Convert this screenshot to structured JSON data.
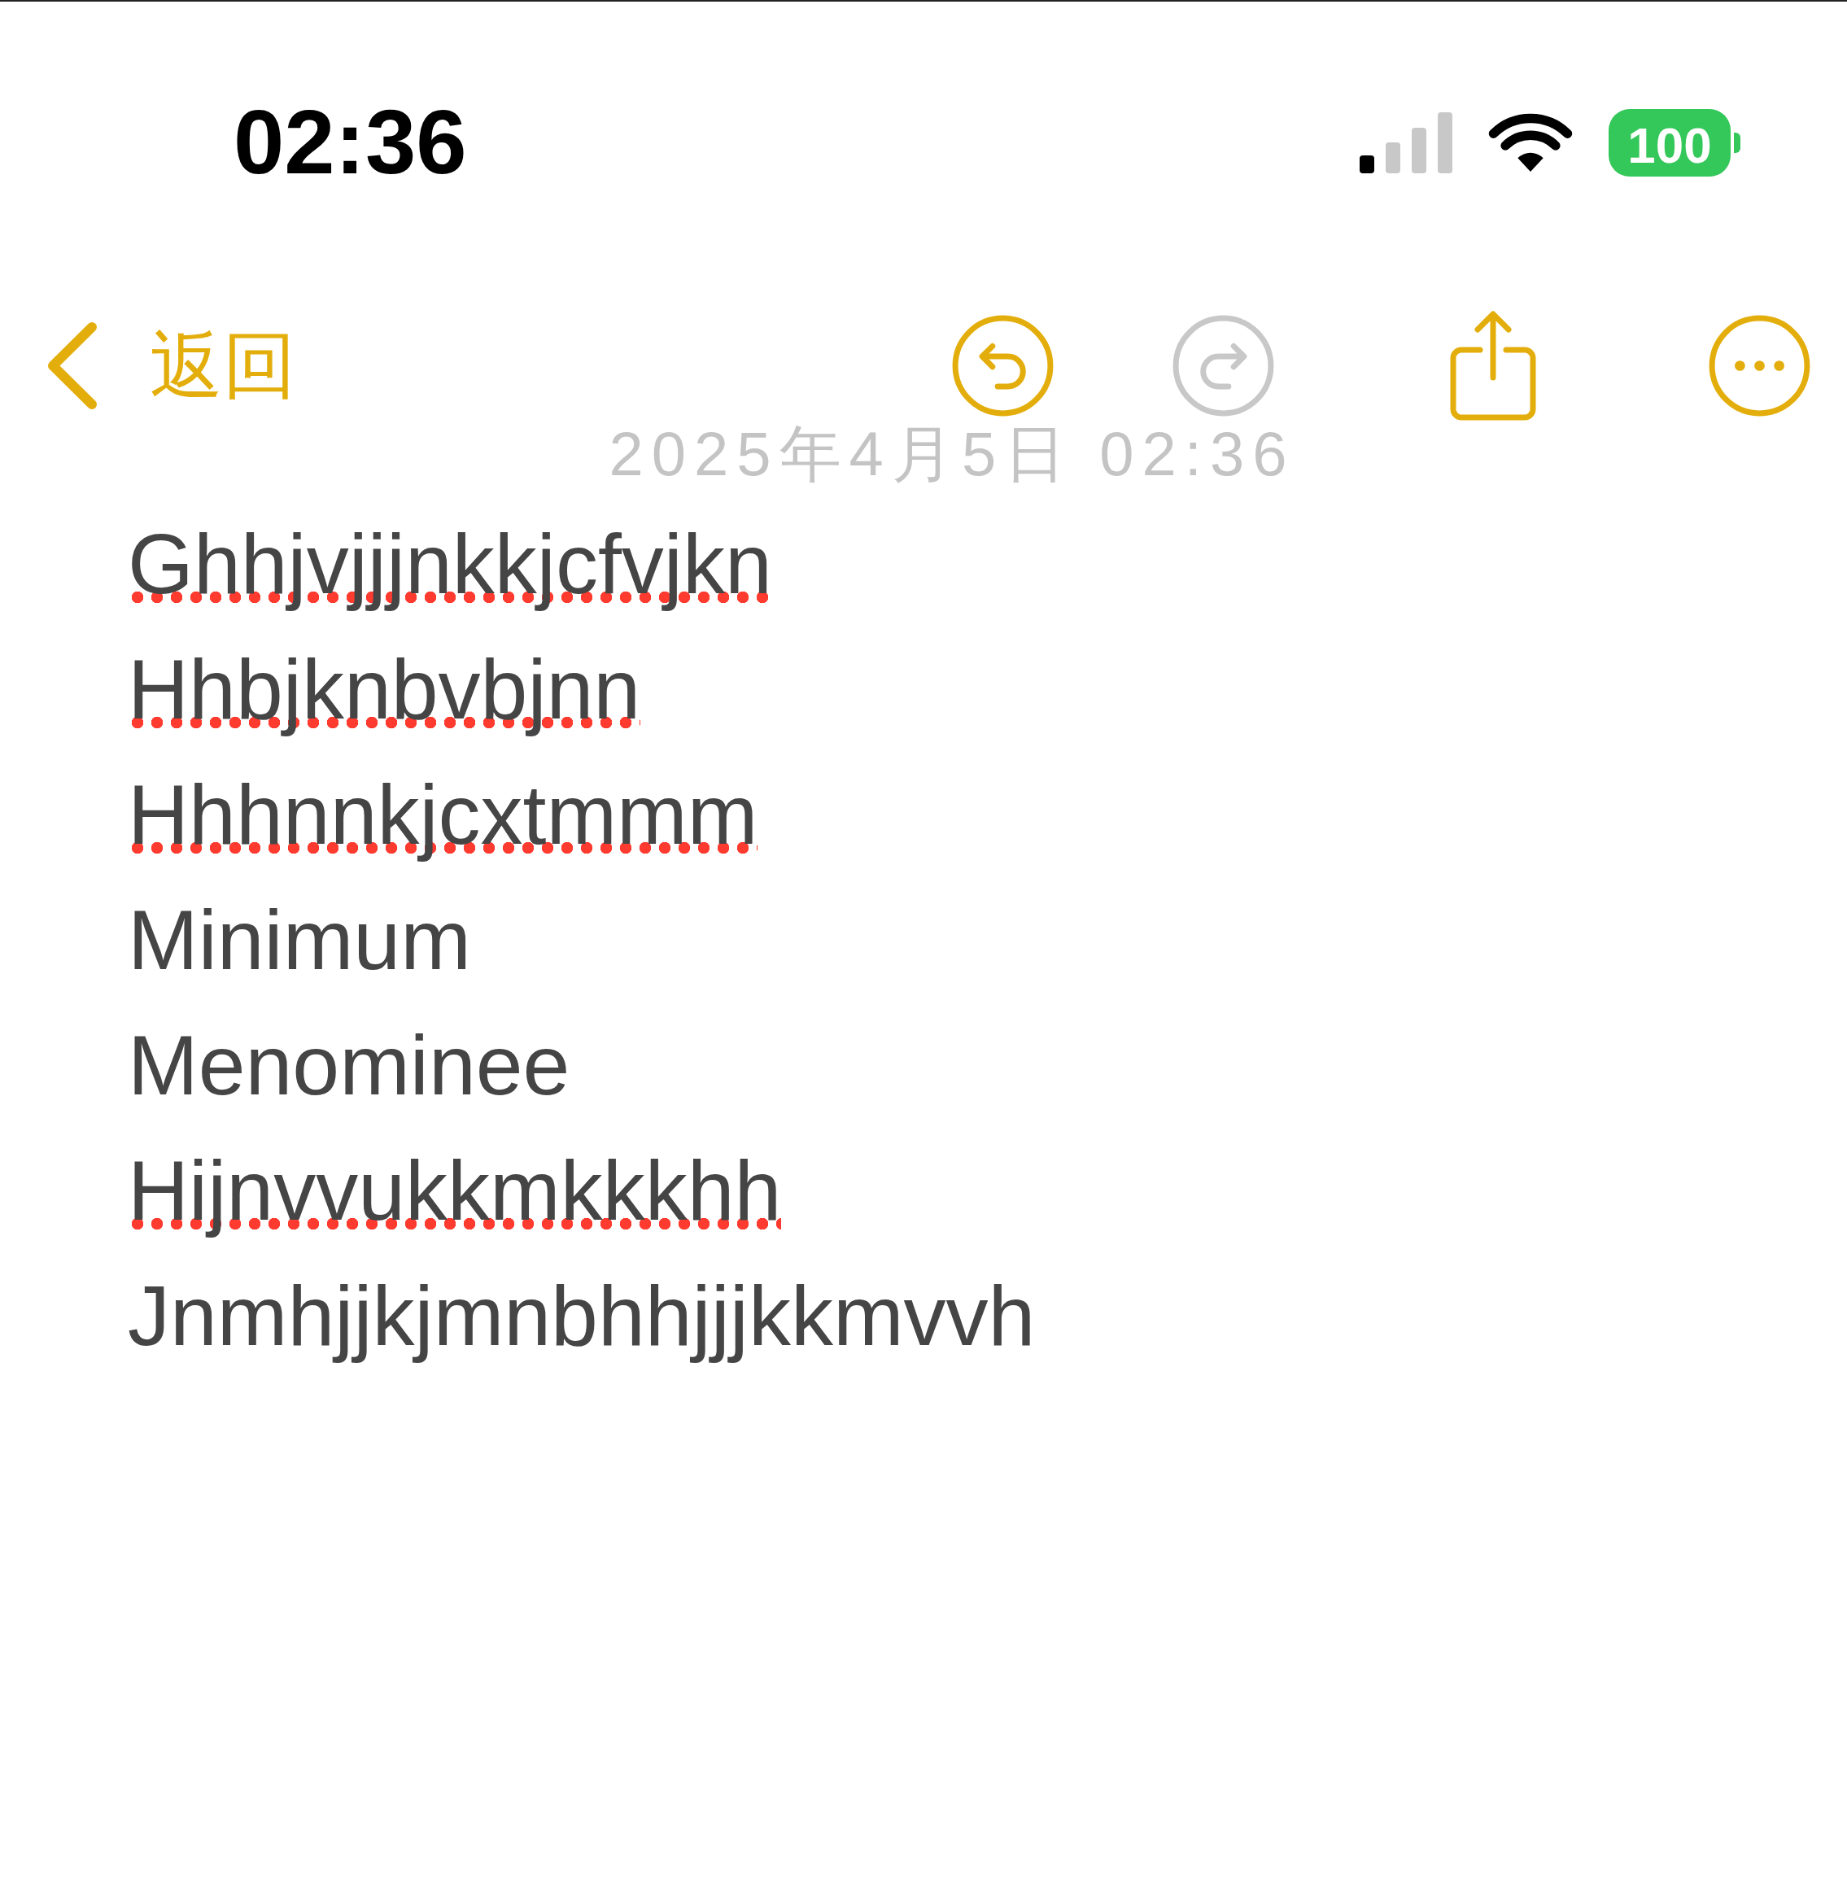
{
  "status_bar": {
    "time": "02:36",
    "battery": "100"
  },
  "nav_bar": {
    "back_button": {
      "label": "返回"
    },
    "toolbar": [
      {
        "kind": "undo",
        "disabled": false
      },
      {
        "kind": "redo",
        "disabled": true
      },
      {
        "kind": "share",
        "disabled": false
      },
      {
        "kind": "more",
        "disabled": false
      }
    ]
  },
  "note": {
    "date": "2025年4月5日 02:36",
    "lines": [
      {
        "text": "Ghhjvjjjnkkjcfvjkn",
        "misspelled": true
      },
      {
        "text": "Hhbjknbvbjnn",
        "misspelled": true
      },
      {
        "text": "Hhhnnkjcxtmmm",
        "misspelled": true
      },
      {
        "text": "Minimum",
        "misspelled": false
      },
      {
        "text": "Menominee",
        "misspelled": false
      },
      {
        "text": "Hijnvvukkmkkkhh",
        "misspelled": true
      },
      {
        "text": "Jnmhjjkjmnbhhjjjkkmvvh",
        "misspelled": false
      }
    ]
  }
}
